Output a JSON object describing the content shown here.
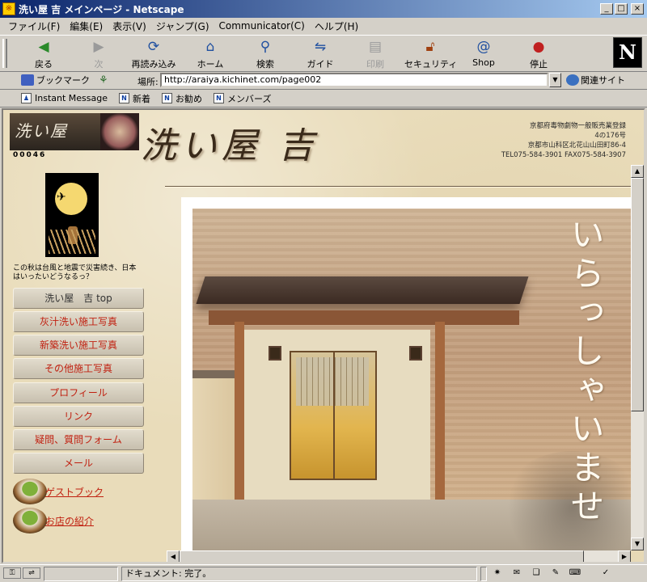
{
  "window": {
    "title": "洗い屋 吉 メインページ - Netscape",
    "minimize": "_",
    "maximize": "□",
    "close": "×"
  },
  "menu": [
    "ファイル(F)",
    "編集(E)",
    "表示(V)",
    "ジャンプ(G)",
    "Communicator(C)",
    "ヘルプ(H)"
  ],
  "toolbar": {
    "back": "戻る",
    "forward": "次",
    "reload": "再読み込み",
    "home": "ホーム",
    "search": "検索",
    "guide": "ガイド",
    "print": "印刷",
    "security": "セキュリティ",
    "shop": "Shop",
    "stop": "停止",
    "brand": "N"
  },
  "locationbar": {
    "bookmarks": "ブックマーク",
    "location_label": "場所:",
    "url": "http://araiya.kichinet.com/page002",
    "related": "関連サイト"
  },
  "personal_toolbar": [
    "Instant Message",
    "新着",
    "お勧め",
    "メンバーズ"
  ],
  "page": {
    "banner_text": "洗い屋",
    "counter": "00046",
    "main_title": "洗い屋 吉",
    "license_line1": "京都府毒物劇物一般販売業登録",
    "license_line2": "4の176号",
    "license_line3": "京都市山科区北花山山田町86-4",
    "license_line4": "TEL075-584-3901 FAX075-584-3907",
    "caption": "この秋は台風と地震で災害続き、日本はいったいどうなるっ？",
    "nav": [
      "洗い屋　吉 top",
      "灰汁洗い施工写真",
      "新築洗い施工写真",
      "その他施工写真",
      "プロフィール",
      "リンク",
      "疑問、質問フォーム",
      "メール"
    ],
    "guestbook": "ゲストブック",
    "shop_intro": "お店の紹介",
    "welcome": "いらっしゃいませ"
  },
  "statusbar": {
    "text": "ドキュメント: 完了。"
  }
}
